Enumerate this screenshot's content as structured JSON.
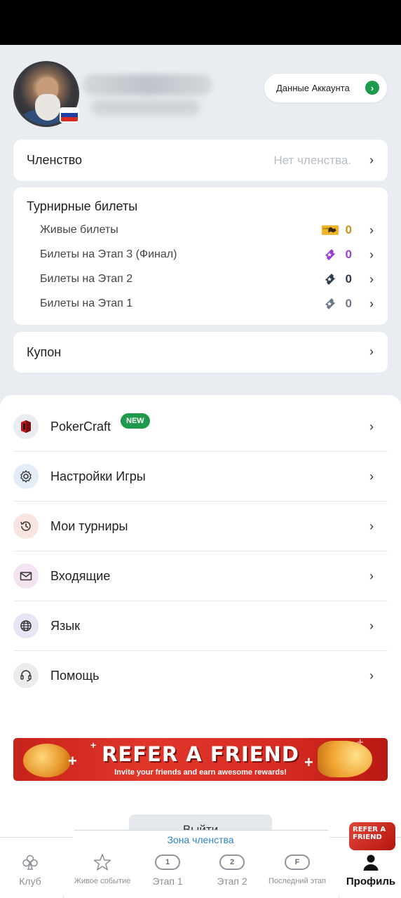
{
  "header": {
    "account_button": "Данные Аккаунта"
  },
  "membership": {
    "title": "Членство",
    "value": "Нет членства."
  },
  "tickets": {
    "title": "Турнирные билеты",
    "items": [
      {
        "label": "Живые билеты",
        "count": "0",
        "color": "#c9941a",
        "icon": "live-ticket-icon"
      },
      {
        "label": "Билеты на Этап 3 (Финал)",
        "count": "0",
        "color": "#9b3fd1",
        "icon": "stage3-ticket-icon"
      },
      {
        "label": "Билеты на Этап 2",
        "count": "0",
        "color": "#2f3a4a",
        "icon": "stage2-ticket-icon"
      },
      {
        "label": "Билеты на Этап 1",
        "count": "0",
        "color": "#6d7a8a",
        "icon": "stage1-ticket-icon"
      }
    ]
  },
  "coupon": {
    "title": "Купон"
  },
  "menu": [
    {
      "label": "PokerCraft",
      "badge": "NEW",
      "icon": "pokercraft-icon"
    },
    {
      "label": "Настройки Игры",
      "icon": "gear-icon"
    },
    {
      "label": "Мои турниры",
      "icon": "history-icon"
    },
    {
      "label": "Входящие",
      "icon": "mail-icon"
    },
    {
      "label": "Язык",
      "icon": "globe-icon"
    },
    {
      "label": "Помощь",
      "icon": "headset-icon"
    }
  ],
  "banner": {
    "headline": "REFER A FRIEND",
    "subtitle": "Invite your friends and earn awesome rewards!"
  },
  "logout_label": "Выйти",
  "bottom_nav": {
    "zone_label": "Зона членства",
    "items": [
      {
        "label": "Клуб",
        "icon": "club-icon"
      },
      {
        "label": "Живое событие",
        "icon": "star-icon"
      },
      {
        "label": "Этап 1",
        "pill": "1"
      },
      {
        "label": "Этап 2",
        "pill": "2"
      },
      {
        "label": "Последний этап",
        "pill": "F"
      },
      {
        "label": "Профиль",
        "icon": "profile-icon",
        "active": true
      }
    ],
    "refer_badge": "REFER A FRIEND"
  },
  "colors": {
    "accent_green": "#1f9a4d",
    "zone_blue": "#2a85c8",
    "background": "#e9edf2"
  }
}
